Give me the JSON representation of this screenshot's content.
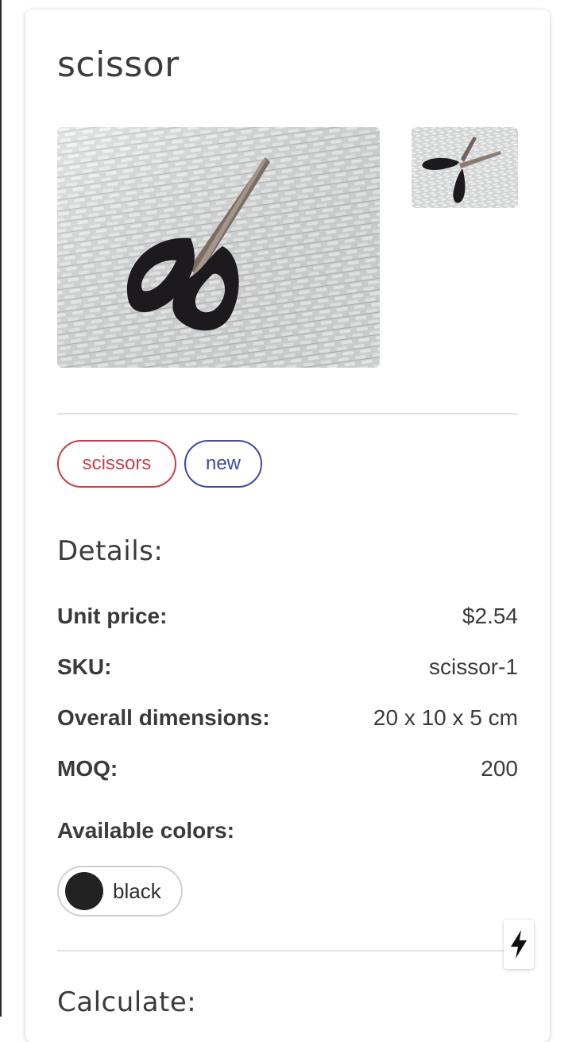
{
  "product": {
    "title": "scissor",
    "main_image_alt": "scissors photo",
    "thumbnail_alt": "scissors thumbnail"
  },
  "tags": [
    {
      "label": "scissors",
      "color": "#cc3d4b"
    },
    {
      "label": "new",
      "color": "#3d4aa6"
    }
  ],
  "details": {
    "heading": "Details:",
    "rows": [
      {
        "label": "Unit price:",
        "value": "$2.54"
      },
      {
        "label": "SKU:",
        "value": "scissor-1"
      },
      {
        "label": "Overall dimensions:",
        "value": "20 x 10 x 5 cm"
      },
      {
        "label": "MOQ:",
        "value": "200"
      }
    ]
  },
  "colors": {
    "label": "Available colors:",
    "options": [
      {
        "name": "black",
        "swatch": "#222222"
      }
    ]
  },
  "calculate": {
    "heading": "Calculate:"
  },
  "fab": {
    "icon": "lightning-bolt-icon"
  }
}
